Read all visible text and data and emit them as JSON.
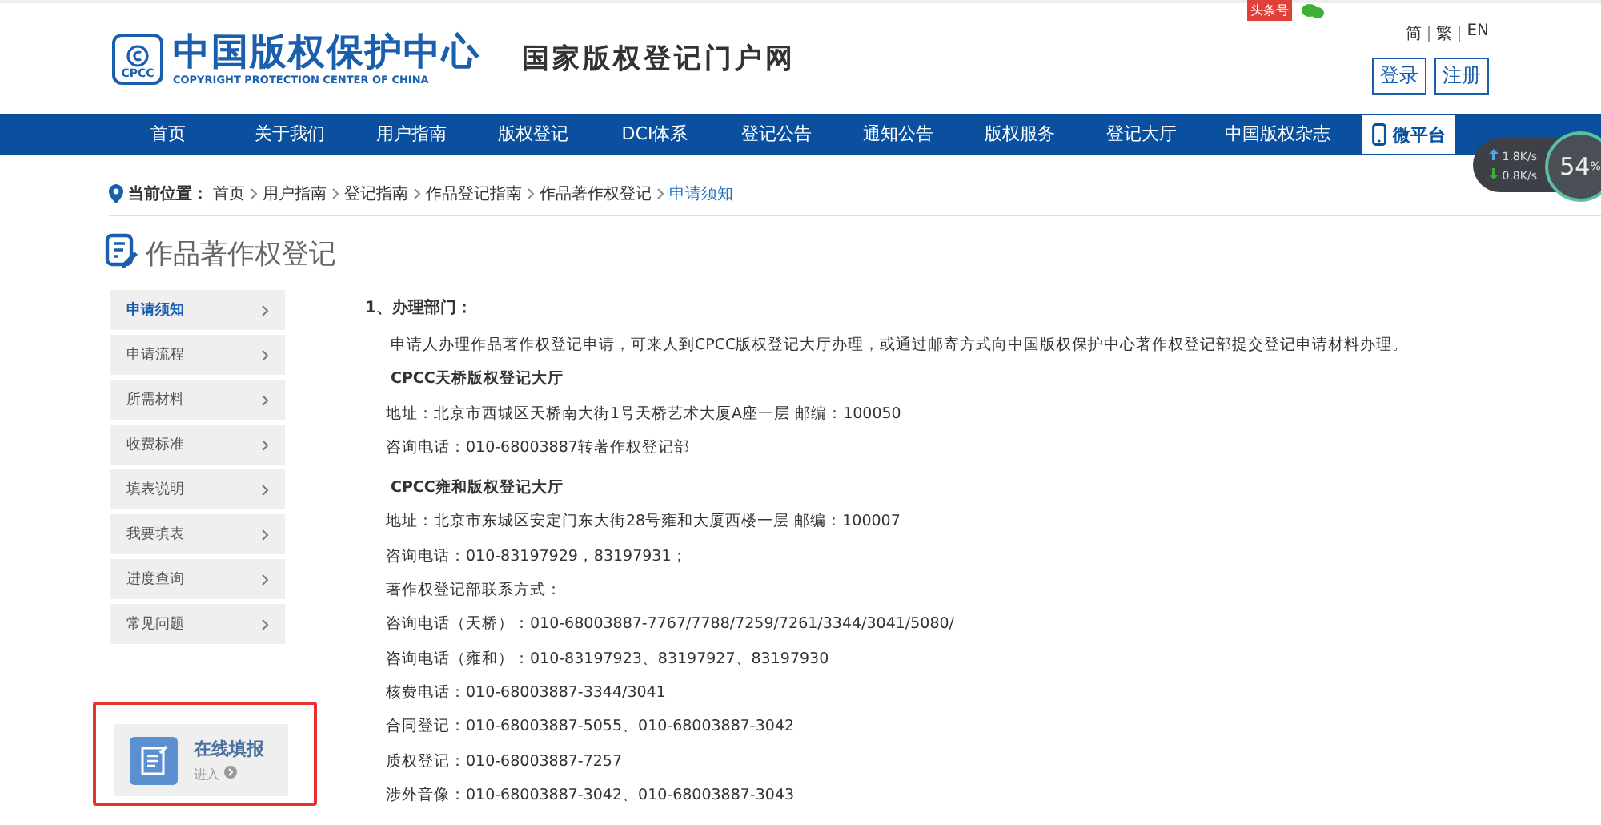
{
  "header": {
    "logo_mark": "CPCC",
    "logo_title": "中国版权保护中心",
    "logo_subtitle": "COPYRIGHT PROTECTION CENTER OF CHINA",
    "portal_name": "国家版权登记门户网",
    "social_badge": "头条号",
    "languages": [
      {
        "label": "简",
        "selected": false
      },
      {
        "label": "繁",
        "selected": false
      },
      {
        "label": "EN",
        "selected": false
      }
    ],
    "buttons": [
      "登录",
      "注册"
    ]
  },
  "nav": {
    "items": [
      {
        "label": "首页",
        "selected": false
      },
      {
        "label": "关于我们",
        "selected": false
      },
      {
        "label": "用户指南",
        "selected": false
      },
      {
        "label": "版权登记",
        "selected": false
      },
      {
        "label": "DCI体系",
        "selected": false
      },
      {
        "label": "登记公告",
        "selected": false
      },
      {
        "label": "通知公告",
        "selected": false
      },
      {
        "label": "版权服务",
        "selected": false
      },
      {
        "label": "登记大厅",
        "selected": false
      },
      {
        "label": "中国版权杂志",
        "selected": false
      }
    ],
    "platform": "微平台"
  },
  "speed_widget": {
    "upload": "1.8",
    "download": "0.8",
    "upload_unit": "K/s",
    "download_unit": "K/s",
    "percent": "54",
    "percent_unit": "%"
  },
  "breadcrumb": {
    "label": "当前位置：",
    "items": [
      {
        "label": "首页",
        "selected": false
      },
      {
        "label": "用户指南",
        "selected": false
      },
      {
        "label": "登记指南",
        "selected": false
      },
      {
        "label": "作品登记指南",
        "selected": false
      },
      {
        "label": "作品著作权登记",
        "selected": false
      },
      {
        "label": "申请须知",
        "selected": true
      }
    ]
  },
  "page_title": "作品著作权登记",
  "sidebar": {
    "items": [
      {
        "label": "申请须知",
        "selected": true
      },
      {
        "label": "申请流程",
        "selected": false
      },
      {
        "label": "所需材料",
        "selected": false
      },
      {
        "label": "收费标准",
        "selected": false
      },
      {
        "label": "填表说明",
        "selected": false
      },
      {
        "label": "我要填表",
        "selected": false
      },
      {
        "label": "进度查询",
        "selected": false
      },
      {
        "label": "常见问题",
        "selected": false
      }
    ],
    "online": {
      "title": "在线填报",
      "link": "进入",
      "highlighted": true
    }
  },
  "content": [
    {
      "kind": "heading",
      "text": "1、办理部门："
    },
    {
      "kind": "paragraph",
      "text": "申请人办理作品著作权登记申请，可来人到CPCC版权登记大厅办理，或通过邮寄方式向中国版权保护中心著作权登记部提交登记申请材料办理。"
    },
    {
      "kind": "subheading",
      "text": "CPCC天桥版权登记大厅"
    },
    {
      "kind": "line",
      "text": "地址：北京市西城区天桥南大街1号天桥艺术大厦A座一层  邮编：100050"
    },
    {
      "kind": "line",
      "text": "咨询电话：010-68003887转著作权登记部"
    },
    {
      "kind": "subheading",
      "text": "CPCC雍和版权登记大厅"
    },
    {
      "kind": "line",
      "text": "地址：北京市东城区安定门东大街28号雍和大厦西楼一层   邮编：100007"
    },
    {
      "kind": "line",
      "text": "咨询电话：010-83197929，83197931；"
    },
    {
      "kind": "line",
      "text": "著作权登记部联系方式："
    },
    {
      "kind": "line",
      "text": "咨询电话（天桥）：010-68003887-7767/7788/7259/7261/3344/3041/5080/"
    },
    {
      "kind": "line",
      "text": "咨询电话（雍和）：010-83197923、83197927、83197930"
    },
    {
      "kind": "line",
      "text": "核费电话：010-68003887-3344/3041"
    },
    {
      "kind": "line",
      "text": "合同登记：010-68003887-5055、010-68003887-3042"
    },
    {
      "kind": "line",
      "text": "质权登记：010-68003887-7257"
    },
    {
      "kind": "line",
      "text": "涉外音像：010-68003887-3042、010-68003887-3043"
    }
  ]
}
